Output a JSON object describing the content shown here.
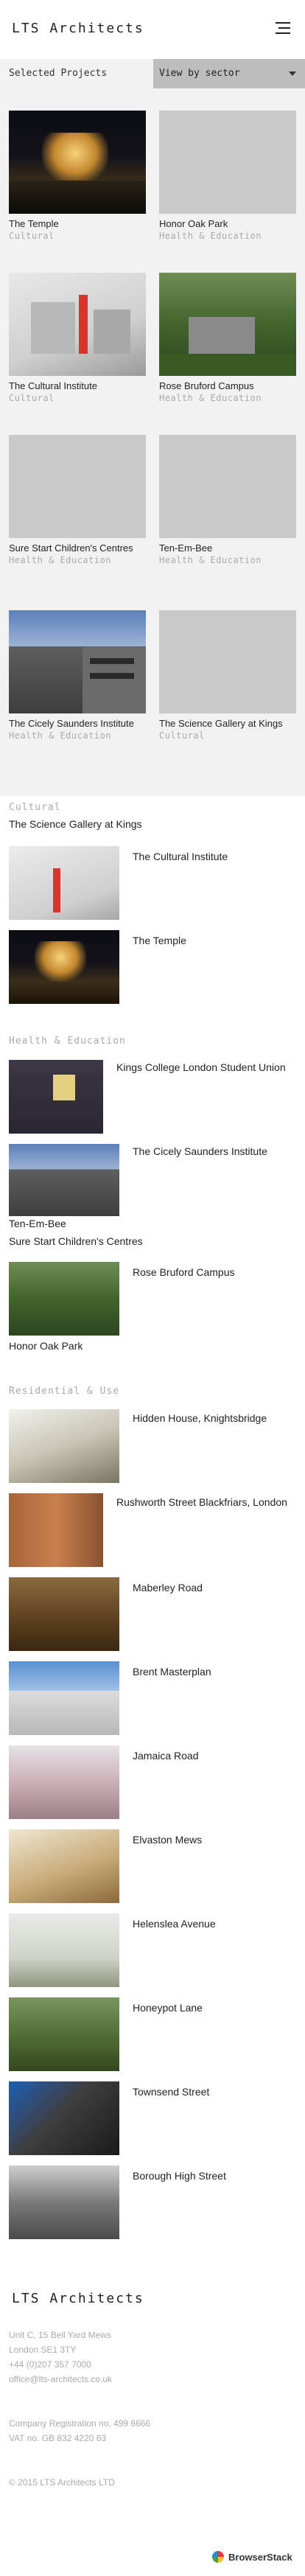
{
  "brand": {
    "name": "LTS Architects"
  },
  "filter": {
    "label": "Selected Projects",
    "selected": "View by sector"
  },
  "projects": [
    {
      "title": "The Temple",
      "category": "Cultural"
    },
    {
      "title": "Honor Oak Park",
      "category": "Health & Education"
    },
    {
      "title": "The Cultural Institute",
      "category": "Cultural"
    },
    {
      "title": "Rose Bruford Campus",
      "category": "Health & Education"
    },
    {
      "title": "Sure Start Children's Centres",
      "category": "Health & Education"
    },
    {
      "title": "Ten-Em-Bee",
      "category": "Health & Education"
    },
    {
      "title": "The Cicely Saunders Institute",
      "category": "Health & Education"
    },
    {
      "title": "The Science Gallery at Kings",
      "category": "Cultural"
    }
  ],
  "sectors": {
    "cultural": {
      "heading": "Cultural",
      "plain": [
        "The Science Gallery at Kings"
      ],
      "items": [
        "The Cultural Institute",
        "The Temple"
      ]
    },
    "health": {
      "heading": "Health & Education",
      "items": [
        "Kings College London Student Union",
        "The Cicely Saunders Institute",
        "Rose Bruford Campus"
      ],
      "plain": [
        "Ten-Em-Bee",
        "Sure Start Children's Centres",
        "Honor Oak Park"
      ]
    },
    "residential": {
      "heading": "Residential & Use",
      "items": [
        "Hidden House, Knightsbridge",
        "Rushworth Street Blackfriars, London",
        "Maberley Road",
        "Brent Masterplan",
        "Jamaica Road",
        "Elvaston Mews",
        "Helenslea Avenue",
        "Honeypot Lane",
        "Townsend Street",
        "Borough High Street"
      ]
    }
  },
  "footer": {
    "logo": "LTS Architects",
    "address": [
      "Unit C, 15 Bell Yard Mews",
      "London SE1 3TY",
      "+44 (0)207 357 7000",
      "office@lts-architects.co.uk"
    ],
    "company": [
      "Company Registration no. 499 6666",
      "VAT no. GB 832 4220 63"
    ],
    "copyright": "© 2015 LTS Architects LTD"
  },
  "badge": {
    "label": "BrowserStack"
  }
}
